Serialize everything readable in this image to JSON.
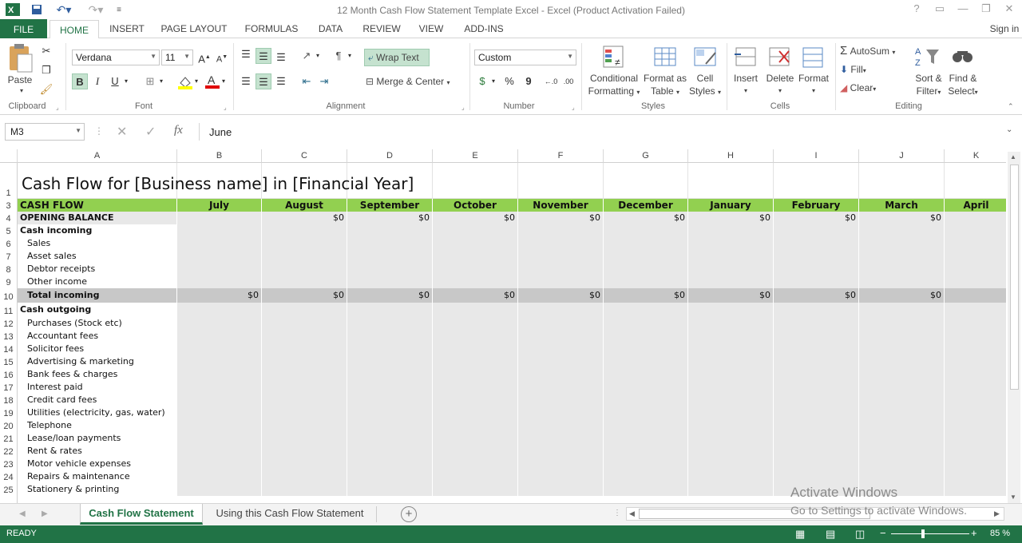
{
  "window": {
    "title": "12 Month Cash Flow Statement Template Excel - Excel (Product Activation Failed)",
    "controls": [
      "?",
      "▭",
      "—",
      "❐",
      "✕"
    ]
  },
  "tabs": [
    "FILE",
    "HOME",
    "INSERT",
    "PAGE LAYOUT",
    "FORMULAS",
    "DATA",
    "REVIEW",
    "VIEW",
    "ADD-INS"
  ],
  "sign_in": "Sign in",
  "ribbon": {
    "clipboard": {
      "paste": "Paste",
      "label": "Clipboard"
    },
    "font": {
      "name": "Verdana",
      "size": "11",
      "bold": "B",
      "italic": "I",
      "underline": "U",
      "label": "Font"
    },
    "alignment": {
      "wrap_text": "Wrap Text",
      "merge_center": "Merge & Center",
      "label": "Alignment"
    },
    "number": {
      "format": "Custom",
      "percent": "%",
      "comma": "9",
      "label": "Number"
    },
    "styles": {
      "conditional_1": "Conditional",
      "conditional_2": "Formatting",
      "format_table_1": "Format as",
      "format_table_2": "Table",
      "cell_styles_1": "Cell",
      "cell_styles_2": "Styles",
      "label": "Styles"
    },
    "cells": {
      "insert": "Insert",
      "delete": "Delete",
      "format": "Format",
      "label": "Cells"
    },
    "editing": {
      "autosum": "AutoSum",
      "fill": "Fill",
      "clear": "Clear",
      "sort_1": "Sort &",
      "sort_2": "Filter",
      "find_1": "Find &",
      "find_2": "Select",
      "label": "Editing"
    }
  },
  "formula_bar": {
    "name_box": "M3",
    "fx": "fx",
    "value": "June"
  },
  "columns": [
    "A",
    "B",
    "C",
    "D",
    "E",
    "F",
    "G",
    "H",
    "I",
    "J",
    "K"
  ],
  "sheet": {
    "title": "Cash Flow for [Business name] in [Financial Year]",
    "header_label": "CASH FLOW",
    "months": [
      "July",
      "August",
      "September",
      "October",
      "November",
      "December",
      "January",
      "February",
      "March",
      "April"
    ],
    "opening_balance": {
      "label": "OPENING BALANCE",
      "values": [
        "",
        "$0",
        "$0",
        "$0",
        "$0",
        "$0",
        "$0",
        "$0",
        "$0",
        ""
      ]
    },
    "cash_incoming": "Cash incoming",
    "incoming_items": [
      "Sales",
      "Asset sales",
      "Debtor receipts",
      "Other income"
    ],
    "total_incoming": {
      "label": "Total incoming",
      "values": [
        "$0",
        "$0",
        "$0",
        "$0",
        "$0",
        "$0",
        "$0",
        "$0",
        "$0",
        ""
      ]
    },
    "cash_outgoing": "Cash outgoing",
    "outgoing_items": [
      "Purchases (Stock etc)",
      "Accountant fees",
      "Solicitor fees",
      "Advertising & marketing",
      "Bank fees & charges",
      "Interest paid",
      "Credit card fees",
      "Utilities (electricity, gas, water)",
      "Telephone",
      "Lease/loan payments",
      "Rent & rates",
      "Motor vehicle expenses",
      "Repairs & maintenance",
      "Stationery & printing"
    ],
    "row_numbers": [
      "1",
      "3",
      "4",
      "5",
      "6",
      "7",
      "8",
      "9",
      "10",
      "11",
      "12",
      "13",
      "14",
      "15",
      "16",
      "17",
      "18",
      "19",
      "20",
      "21",
      "22",
      "23",
      "24",
      "25"
    ]
  },
  "sheet_tabs": [
    "Cash Flow Statement",
    "Using this Cash Flow Statement"
  ],
  "status": {
    "ready": "READY",
    "zoom": "85 %"
  },
  "watermark": {
    "line1": "Activate Windows",
    "line2": "Go to Settings to activate Windows."
  },
  "colors": {
    "excel_green": "#217346",
    "header_green": "#92d050",
    "row_gray": "#e8e8e8",
    "total_gray": "#c8c8c8"
  }
}
